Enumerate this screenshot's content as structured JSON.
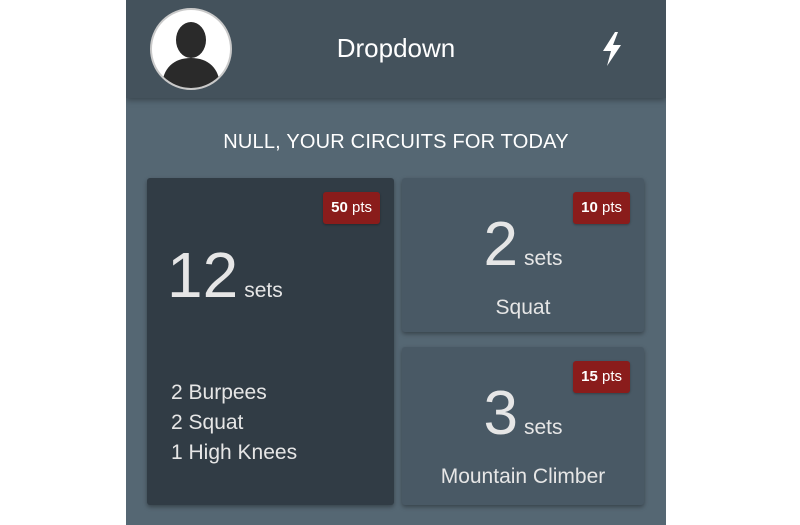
{
  "header": {
    "title": "Dropdown",
    "avatar_icon": "user-silhouette-icon",
    "action_icon": "lightning-bolt-icon"
  },
  "heading": "NULL, YOUR CIRCUITS FOR TODAY",
  "circuits": [
    {
      "points": "50",
      "points_unit": "pts",
      "sets": "12",
      "sets_unit": "sets",
      "exercises": [
        "2 Burpees",
        "2 Squat",
        "1 High Knees"
      ]
    },
    {
      "points": "10",
      "points_unit": "pts",
      "sets": "2",
      "sets_unit": "sets",
      "name": "Squat"
    },
    {
      "points": "15",
      "points_unit": "pts",
      "sets": "3",
      "sets_unit": "sets",
      "name": "Mountain Climber"
    }
  ],
  "colors": {
    "header": "#44525c",
    "background": "#556773",
    "card_dark": "#313c45",
    "card": "#495965",
    "badge": "#8a1c1b"
  }
}
